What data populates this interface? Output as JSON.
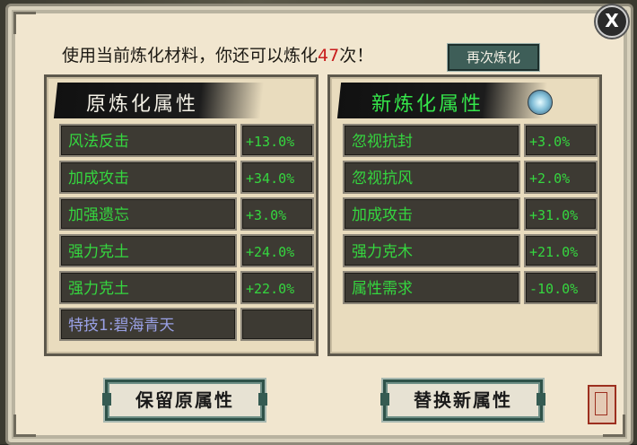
{
  "dialog": {
    "close_label": "X",
    "info_text_prefix": "使用当前炼化材料，你还可以炼化",
    "info_count": "47",
    "info_text_suffix": "次！",
    "refine_again_label": "再次炼化"
  },
  "left_panel": {
    "title": "原炼化属性",
    "rows": [
      {
        "name": "风法反击",
        "value": "+13.0%"
      },
      {
        "name": "加成攻击",
        "value": "+34.0%"
      },
      {
        "name": "加强遗忘",
        "value": "+3.0%"
      },
      {
        "name": "强力克土",
        "value": "+24.0%"
      },
      {
        "name": "强力克土",
        "value": "+22.0%"
      },
      {
        "name": "特技1:碧海青天",
        "value": ""
      }
    ]
  },
  "right_panel": {
    "title": "新炼化属性",
    "rows": [
      {
        "name": "忽视抗封",
        "value": "+3.0%"
      },
      {
        "name": "忽视抗风",
        "value": "+2.0%"
      },
      {
        "name": "加成攻击",
        "value": "+31.0%"
      },
      {
        "name": "强力克木",
        "value": "+21.0%"
      },
      {
        "name": "属性需求",
        "value": "-10.0%"
      }
    ]
  },
  "buttons": {
    "keep_label": "保留原属性",
    "replace_label": "替换新属性"
  },
  "colors": {
    "attribute_green": "#35d63f",
    "skill_purple": "#9aa1e6",
    "count_red": "#c81d1d"
  }
}
